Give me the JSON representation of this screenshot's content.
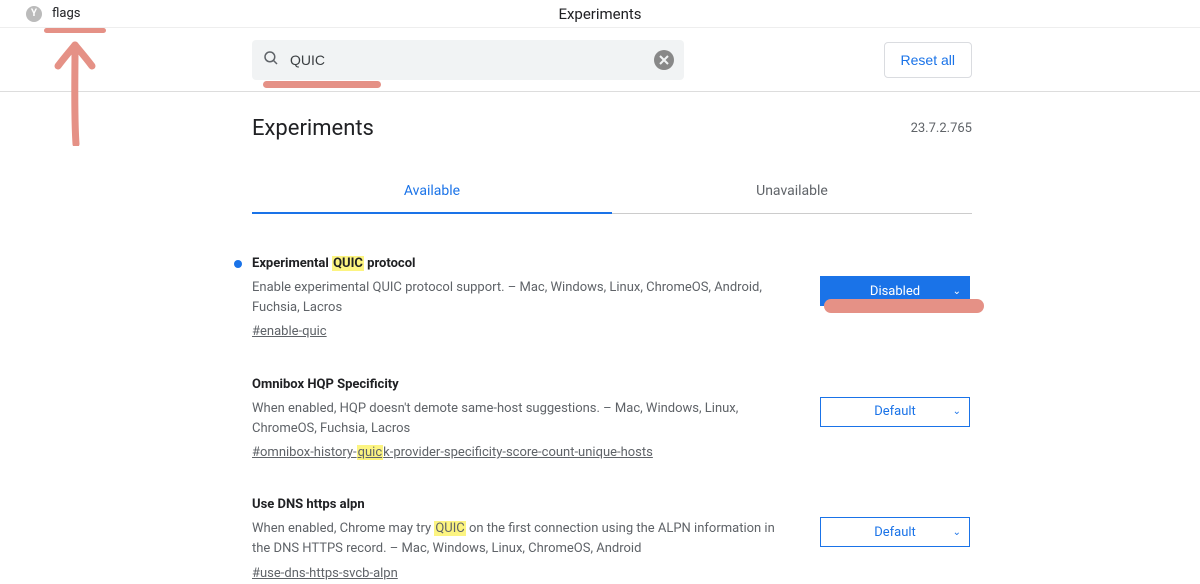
{
  "header": {
    "tab_title": "flags",
    "center_title": "Experiments"
  },
  "search": {
    "value": "QUIC"
  },
  "toolbar": {
    "reset_all_label": "Reset all"
  },
  "page": {
    "heading": "Experiments",
    "version": "23.7.2.765"
  },
  "tabs": {
    "available": "Available",
    "unavailable": "Unavailable"
  },
  "selects": {
    "disabled": "Disabled",
    "default": "Default"
  },
  "experiments": [
    {
      "modified": true,
      "title_pre": "Experimental ",
      "title_hl": "QUIC",
      "title_post": " protocol",
      "desc": "Enable experimental QUIC protocol support. – Mac, Windows, Linux, ChromeOS, Android, Fuchsia, Lacros",
      "hash": "#enable-quic",
      "hash_pre": "#enable-quic",
      "hash_hl": "",
      "hash_post": "",
      "value": "disabled"
    },
    {
      "modified": false,
      "title_pre": "Omnibox HQP Specificity",
      "title_hl": "",
      "title_post": "",
      "desc": "When enabled, HQP doesn't demote same-host suggestions. – Mac, Windows, Linux, ChromeOS, Fuchsia, Lacros",
      "hash": "#omnibox-history-quick-provider-specificity-score-count-unique-hosts",
      "hash_pre": "#omnibox-history-",
      "hash_hl": "quic",
      "hash_post": "k-provider-specificity-score-count-unique-hosts",
      "value": "default"
    },
    {
      "modified": false,
      "title_pre": "Use DNS https alpn",
      "title_hl": "",
      "title_post": "",
      "desc_pre": "When enabled, Chrome may try ",
      "desc_hl": "QUIC",
      "desc_post": " on the first connection using the ALPN information in the DNS HTTPS record. – Mac, Windows, Linux, ChromeOS, Android",
      "hash": "#use-dns-https-svcb-alpn",
      "hash_pre": "#use-dns-https-svcb-alpn",
      "hash_hl": "",
      "hash_post": "",
      "value": "default"
    }
  ],
  "annotations": {
    "color": "#e59186"
  }
}
